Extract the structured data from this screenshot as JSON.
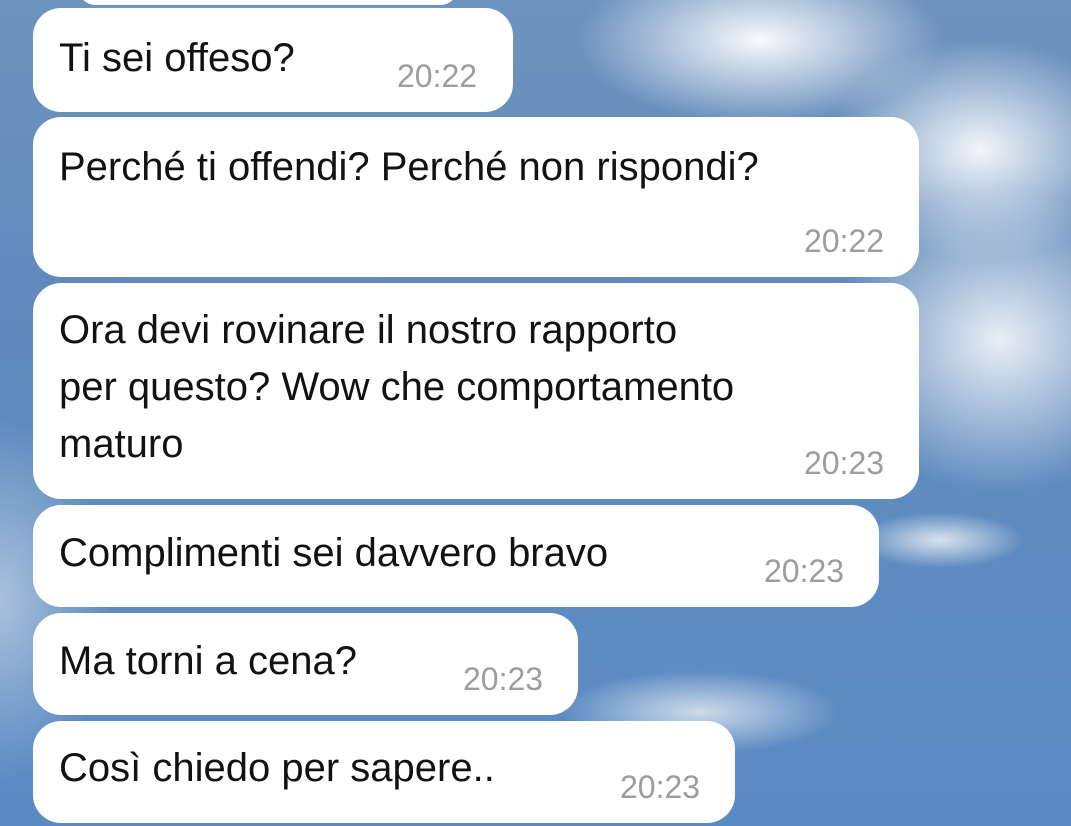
{
  "messages": [
    {
      "text": "Ti sei offeso?",
      "time": "20:22"
    },
    {
      "text": "Perché ti offendi? Perché non rispondi?",
      "time": "20:22"
    },
    {
      "lines": [
        "Ora devi rovinare il nostro rapporto",
        "per questo? Wow che comportamento",
        "maturo"
      ],
      "time": "20:23"
    },
    {
      "text": "Complimenti sei davvero bravo",
      "time": "20:23"
    },
    {
      "text": "Ma torni a cena?",
      "time": "20:23"
    },
    {
      "text": "Così chiedo per sapere..",
      "time": "20:23"
    }
  ]
}
